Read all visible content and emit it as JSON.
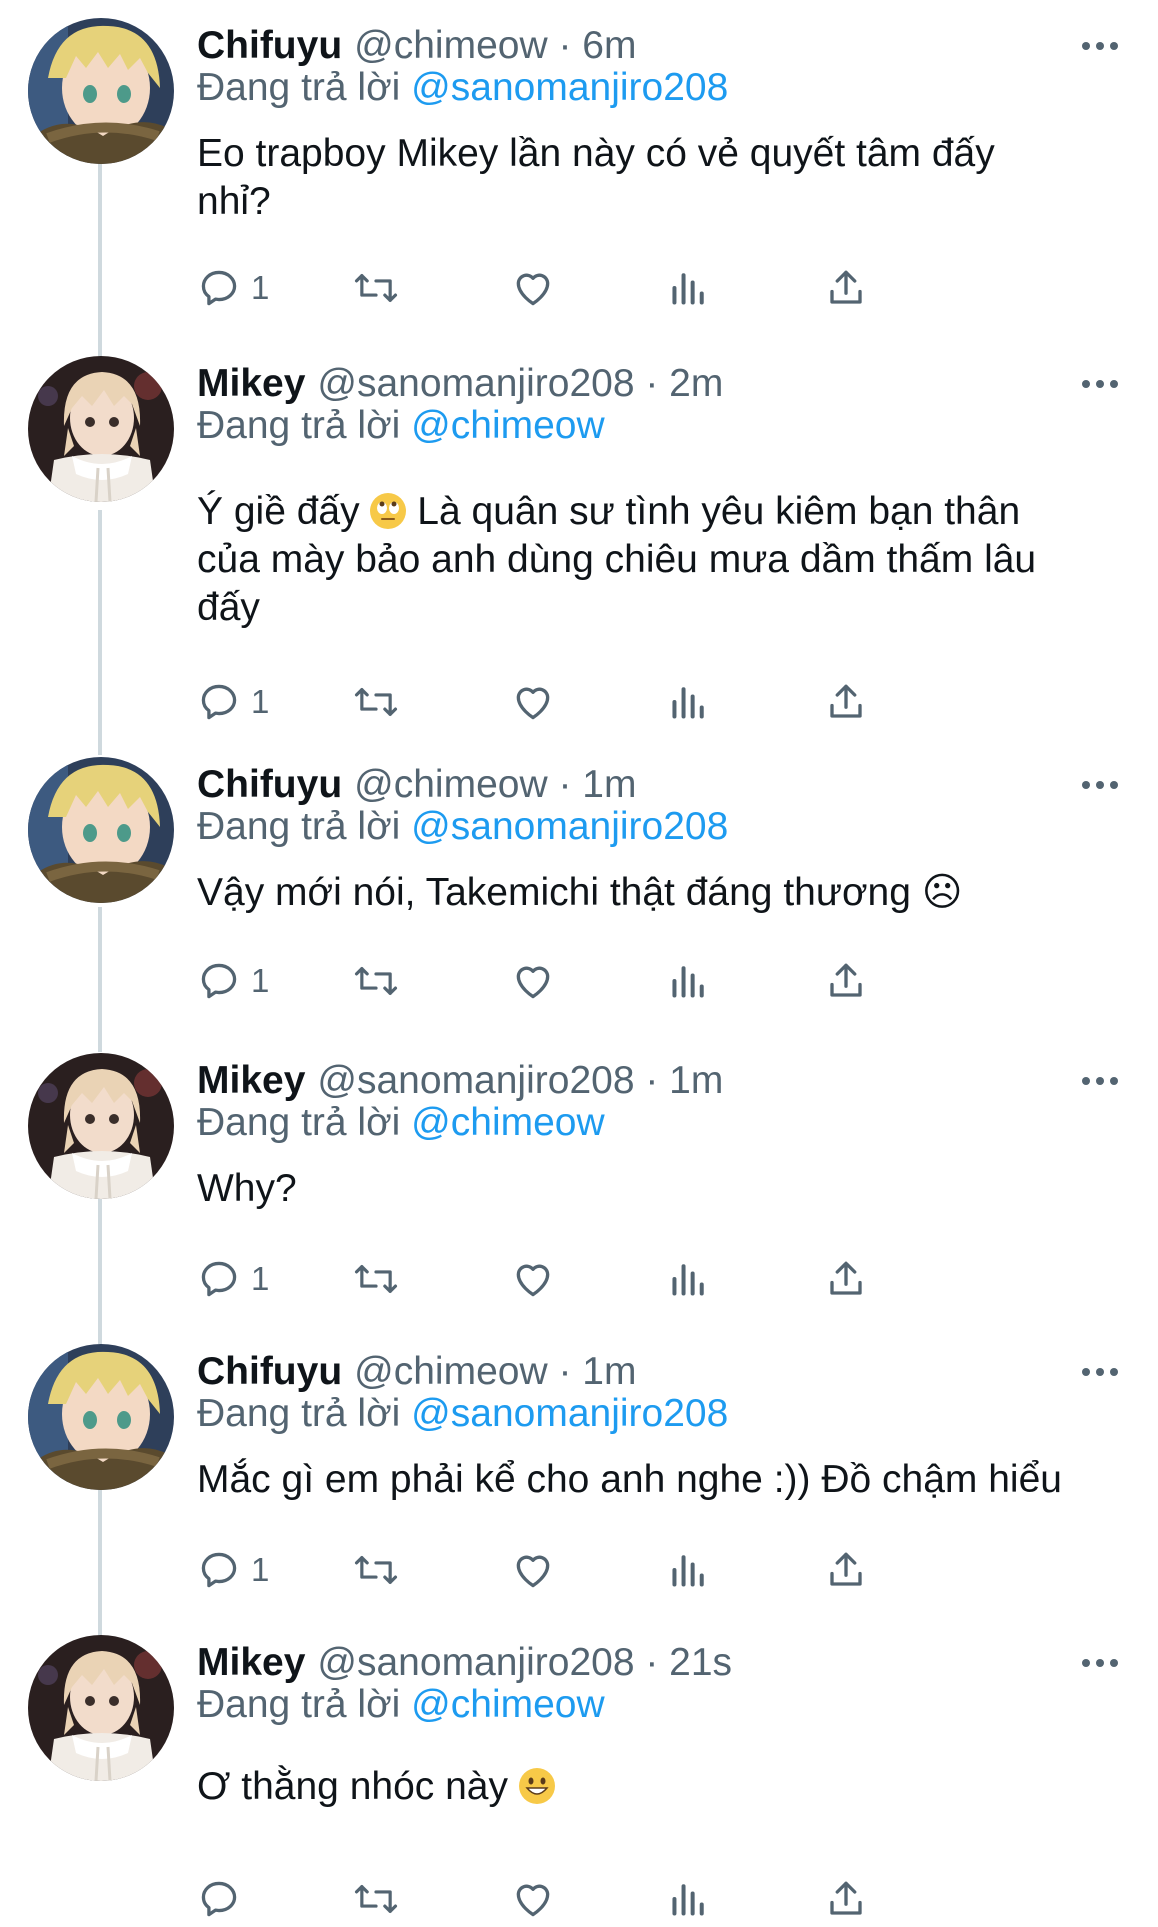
{
  "reply_prefix": "Đang trả lời",
  "tweets": [
    {
      "name": "Chifuyu",
      "meta": "@chimeow · 6m",
      "reply_to": "@sanomanjiro208",
      "text": "Eo trapboy Mikey lần này có vẻ quyết tâm đấy\nnhỉ?",
      "reply_count": "1",
      "avatar": "chifuyu-avatar"
    },
    {
      "name": "Mikey",
      "meta": "@sanomanjiro208 · 2m",
      "reply_to": "@chimeow",
      "text_before": "Ý giề đấy ",
      "emoji": "rolling-eyes-emoji",
      "text_after": " Là quân sư tình yêu kiêm bạn thân\ncủa mày bảo anh dùng chiêu mưa dầm thấm lâu\nđấy",
      "reply_count": "1",
      "avatar": "mikey-avatar"
    },
    {
      "name": "Chifuyu",
      "meta": "@chimeow · 1m",
      "reply_to": "@sanomanjiro208",
      "text": "Vậy mới nói, Takemichi thật đáng thương ☹",
      "reply_count": "1",
      "avatar": "chifuyu-avatar"
    },
    {
      "name": "Mikey",
      "meta": "@sanomanjiro208 · 1m",
      "reply_to": "@chimeow",
      "text": "Why?",
      "reply_count": "1",
      "avatar": "mikey-avatar"
    },
    {
      "name": "Chifuyu",
      "meta": "@chimeow · 1m",
      "reply_to": "@sanomanjiro208",
      "text": "Mắc gì em phải kể cho anh nghe :)) Đồ chậm hiểu",
      "reply_count": "1",
      "avatar": "chifuyu-avatar"
    },
    {
      "name": "Mikey",
      "meta": "@sanomanjiro208 · 21s",
      "reply_to": "@chimeow",
      "text_before": "Ơ thằng nhóc này ",
      "emoji": "grinning-emoji",
      "text_after": "",
      "reply_count": "",
      "avatar": "mikey-avatar"
    }
  ],
  "colors": {
    "text": "#0f1419",
    "secondary": "#536471",
    "mention": "#1d9bf0",
    "thread_line": "#cfd9de"
  },
  "icons": [
    "reply-icon",
    "retweet-icon",
    "like-icon",
    "analytics-icon",
    "share-icon",
    "more-icon"
  ]
}
